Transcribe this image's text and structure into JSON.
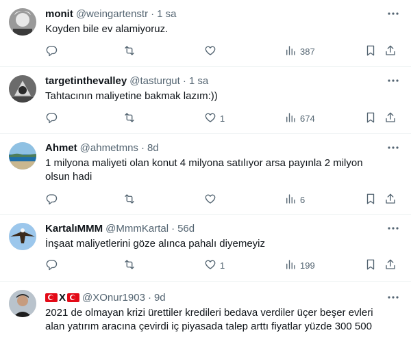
{
  "tweets": [
    {
      "name": "monit",
      "handle": "@weingartenstr",
      "time": "1 sa",
      "text": "Koyden bile ev alamiyoruz.",
      "replies": "",
      "retweets": "",
      "likes": "",
      "views": "387"
    },
    {
      "name": "targetinthevalley",
      "handle": "@tasturgut",
      "time": "1 sa",
      "text": "Tahtacının maliyetine bakmak lazım:))",
      "replies": "",
      "retweets": "",
      "likes": "1",
      "views": "674"
    },
    {
      "name": "Ahmet",
      "handle": "@ahmetmns",
      "time": "8d",
      "text": "1 milyona maliyeti olan konut 4 milyona satılıyor arsa payınla 2 milyon olsun hadi",
      "replies": "",
      "retweets": "",
      "likes": "",
      "views": "6"
    },
    {
      "name": "KartalıMMM",
      "handle": "@MmmKartal",
      "time": "56d",
      "text": "İnşaat maliyetlerini göze alınca pahalı diyemeyiz",
      "replies": "",
      "retweets": "",
      "likes": "1",
      "views": "199"
    },
    {
      "name_mid": "X",
      "handle": "@XOnur1903",
      "time": "9d",
      "text": "2021 de olmayan krizi ürettiler kredileri bedava verdiler üçer beşer evleri alan yatırım aracına çevirdi iç piyasada talep arttı fiyatlar yüzde 300 500"
    }
  ],
  "separator": "·",
  "icons": {
    "more": "more-dots-icon",
    "reply": "reply-icon",
    "retweet": "retweet-icon",
    "like": "heart-icon",
    "views": "views-chart-icon",
    "bookmark": "bookmark-icon",
    "share": "share-icon"
  },
  "colors": {
    "text": "#0f1419",
    "secondary": "#536471",
    "divider": "#eff3f4",
    "flag_red": "#e30a17"
  }
}
